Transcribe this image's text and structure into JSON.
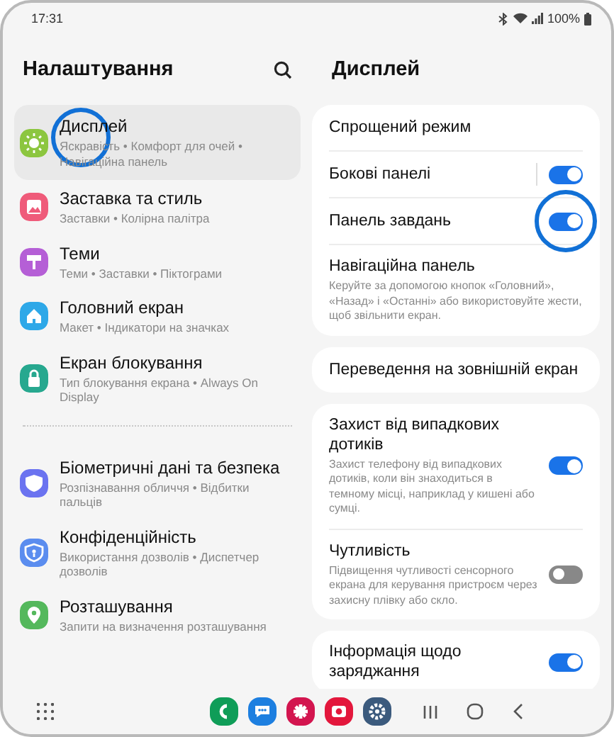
{
  "status_bar": {
    "time": "17:31",
    "battery": "100%"
  },
  "settings": {
    "title": "Налаштування",
    "groups": [
      {
        "items": [
          {
            "title": "Дисплей",
            "subtitle": "Яскравість • Комфорт для очей • Навігаційна панель",
            "color": "#8cc63f",
            "selected": true,
            "highlighted": true
          },
          {
            "title": "Заставка та стиль",
            "subtitle": "Заставки • Колірна палітра",
            "color": "#ef5b7a",
            "selected": false,
            "highlighted": false
          },
          {
            "title": "Теми",
            "subtitle": "Теми • Заставки • Піктограми",
            "color": "#b55fd6",
            "selected": false,
            "highlighted": false
          },
          {
            "title": "Головний екран",
            "subtitle": "Макет • Індикатори на значках",
            "color": "#2ea8e8",
            "selected": false,
            "highlighted": false
          },
          {
            "title": "Екран блокування",
            "subtitle": "Тип блокування екрана • Always On Display",
            "color": "#27a88f",
            "selected": false,
            "highlighted": false
          }
        ]
      },
      {
        "items": [
          {
            "title": "Біометричні дані та безпека",
            "subtitle": "Розпізнавання обличчя • Відбитки пальців",
            "color": "#6b73f0",
            "selected": false,
            "highlighted": false
          },
          {
            "title": "Конфіденційність",
            "subtitle": "Використання дозволів • Диспетчер дозволів",
            "color": "#5b8def",
            "selected": false,
            "highlighted": false
          },
          {
            "title": "Розташування",
            "subtitle": "Запити на визначення розташування",
            "color": "#54b85c",
            "selected": false,
            "highlighted": false
          }
        ]
      }
    ]
  },
  "detail": {
    "title": "Дисплей",
    "cards": [
      {
        "rows": [
          {
            "kind": "plain",
            "title": "Спрощений режим"
          },
          {
            "kind": "split_toggle",
            "title": "Бокові панелі",
            "on": true
          },
          {
            "kind": "toggle",
            "title": "Панель завдань",
            "on": true,
            "highlighted": true
          },
          {
            "kind": "plain",
            "title": "Навігаційна панель",
            "description": "Керуйте за допомогою кнопок «Головний», «Назад» і «Останні» або використовуйте жести, щоб звільнити екран."
          }
        ]
      },
      {
        "rows": [
          {
            "kind": "plain",
            "title": "Переведення на зовнішній екран"
          }
        ]
      },
      {
        "rows": [
          {
            "kind": "toggle",
            "title": "Захист від випадкових дотиків",
            "description": "Захист телефону від випадкових дотиків, коли він знаходиться в темному місці, наприклад у кишені або сумці.",
            "on": true
          },
          {
            "kind": "toggle",
            "title": "Чутливість",
            "description": "Підвищення чутливості сенсорного екрана для керування пристроєм через захисну плівку або скло.",
            "on": false
          }
        ]
      },
      {
        "rows": [
          {
            "kind": "toggle",
            "title": "Інформація щодо заряджання",
            "on": true
          }
        ]
      }
    ]
  }
}
